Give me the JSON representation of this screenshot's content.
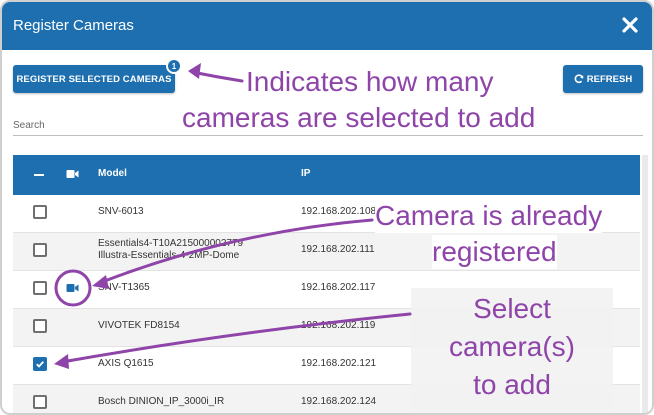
{
  "dialog": {
    "title": "Register Cameras"
  },
  "toolbar": {
    "register_label": "REGISTER SELECTED CAMERAS",
    "selected_count": "1",
    "refresh_label": "REFRESH"
  },
  "search": {
    "label": "Search"
  },
  "table": {
    "headers": {
      "model": "Model",
      "ip": "IP"
    },
    "rows": [
      {
        "model": "SNV-6013",
        "model2": "",
        "ip": "192.168.202.108",
        "checked": false,
        "registered": false
      },
      {
        "model": "Essentials4-T10A215000002779",
        "model2": "Illustra-Essentials-4-2MP-Dome",
        "ip": "192.168.202.111",
        "checked": false,
        "registered": false
      },
      {
        "model": "SNV-T1365",
        "model2": "",
        "ip": "192.168.202.117",
        "checked": false,
        "registered": true
      },
      {
        "model": "VIVOTEK FD8154",
        "model2": "",
        "ip": "192.168.202.119",
        "checked": false,
        "registered": false
      },
      {
        "model": "AXIS Q1615",
        "model2": "",
        "ip": "192.168.202.121",
        "checked": true,
        "registered": false
      },
      {
        "model": "Bosch DINION_IP_3000i_IR",
        "model2": "",
        "ip": "192.168.202.124",
        "checked": false,
        "registered": false
      }
    ]
  },
  "annotations": {
    "count_line1": "Indicates how many",
    "count_line2": "cameras are selected to add",
    "registered_line1": "Camera is already",
    "registered_line2": "registered",
    "select_line1": "Select",
    "select_line2": "camera(s)",
    "select_line3": "to add"
  },
  "colors": {
    "primary": "#1d6fb0",
    "annotation": "#8e44a8"
  },
  "icons": {
    "close": "close-icon",
    "refresh": "refresh-icon",
    "camera": "video-camera-icon",
    "deselect": "minus-icon",
    "check": "check-icon"
  }
}
